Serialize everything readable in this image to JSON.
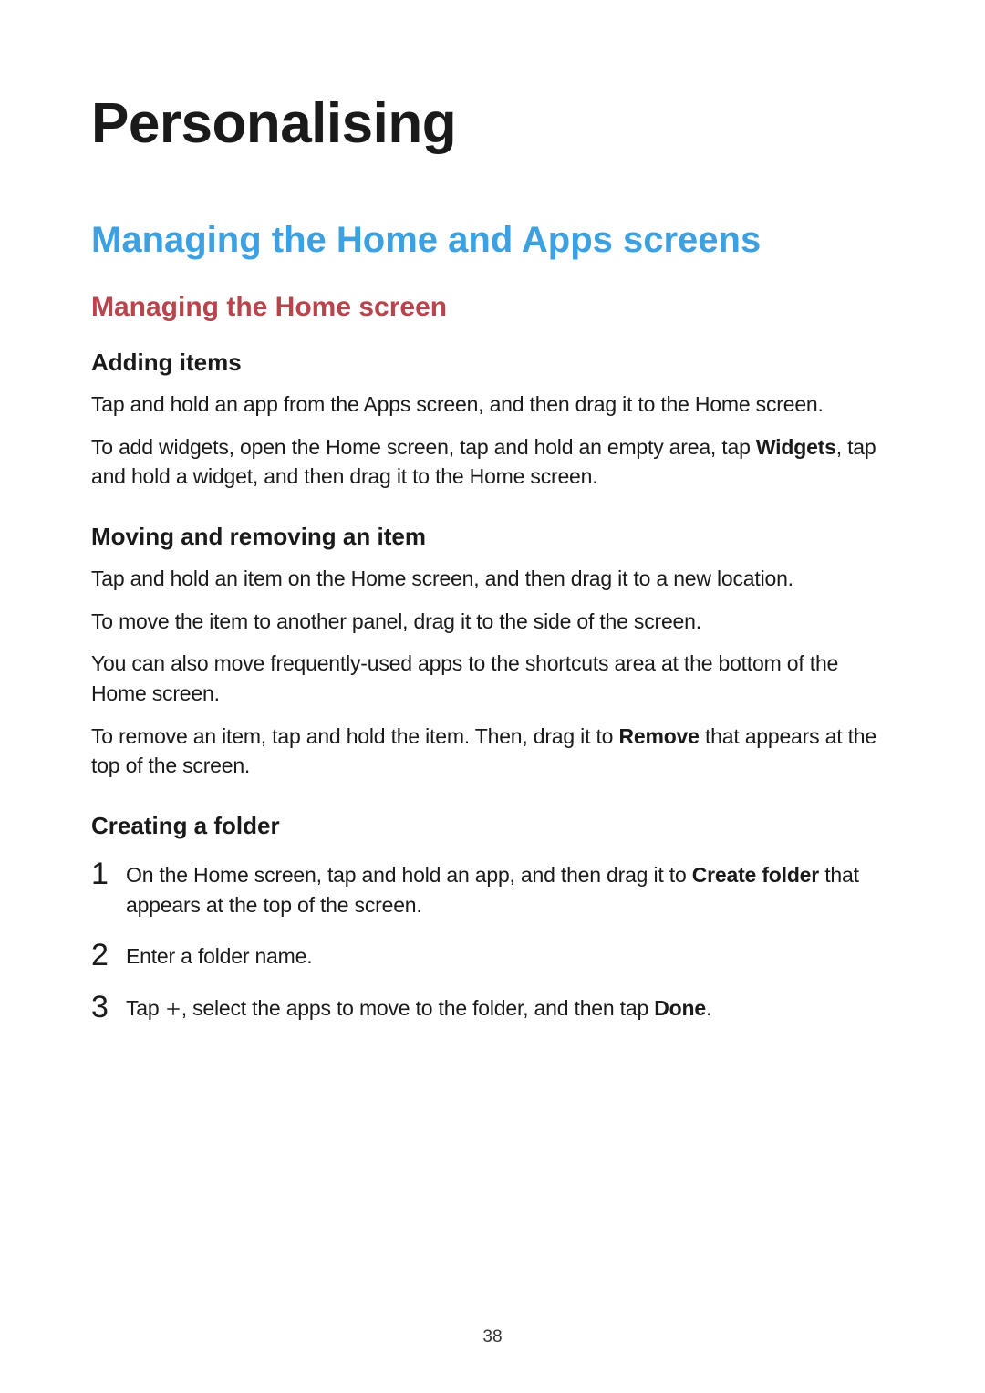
{
  "page_number": "38",
  "title": "Personalising",
  "section_title": "Managing the Home and Apps screens",
  "subsection_title": "Managing the Home screen",
  "adding_items": {
    "heading": "Adding items",
    "p1": "Tap and hold an app from the Apps screen, and then drag it to the Home screen.",
    "p2_a": "To add widgets, open the Home screen, tap and hold an empty area, tap ",
    "p2_bold": "Widgets",
    "p2_b": ", tap and hold a widget, and then drag it to the Home screen."
  },
  "moving": {
    "heading": "Moving and removing an item",
    "p1": "Tap and hold an item on the Home screen, and then drag it to a new location.",
    "p2": "To move the item to another panel, drag it to the side of the screen.",
    "p3": "You can also move frequently-used apps to the shortcuts area at the bottom of the Home screen.",
    "p4_a": "To remove an item, tap and hold the item. Then, drag it to ",
    "p4_bold": "Remove",
    "p4_b": " that appears at the top of the screen."
  },
  "folder": {
    "heading": "Creating a folder",
    "steps": {
      "n1": "1",
      "s1_a": "On the Home screen, tap and hold an app, and then drag it to ",
      "s1_bold": "Create folder",
      "s1_b": " that appears at the top of the screen.",
      "n2": "2",
      "s2": "Enter a folder name.",
      "n3": "3",
      "s3_a": "Tap ",
      "s3_b": ", select the apps to move to the folder, and then tap ",
      "s3_bold": "Done",
      "s3_c": "."
    }
  }
}
